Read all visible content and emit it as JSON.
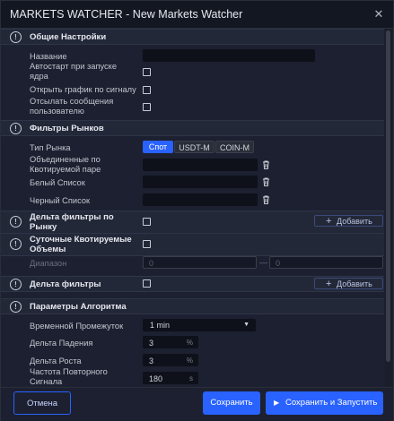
{
  "window": {
    "title": "MARKETS WATCHER - New Markets Watcher",
    "close": "✕"
  },
  "sections": {
    "general": {
      "title": "Общие Настройки",
      "icon": "info-icon"
    },
    "pair_filters": {
      "title": "Фильтры Рынков",
      "icon": "info-icon"
    },
    "delta_market": {
      "title": "Дельта фильтры по Рынку",
      "icon": "info-icon"
    },
    "daily_volumes": {
      "title": "Суточные Квотируемые Объемы",
      "icon": "info-icon"
    },
    "delta_filters": {
      "title": "Дельта фильтры",
      "icon": "info-icon"
    },
    "algo_params": {
      "title": "Параметры Алгоритма",
      "icon": "info-icon"
    }
  },
  "general": {
    "name_label": "Название",
    "name_value": "",
    "autostart_label": "Автостарт при запуске ядра",
    "autostart_checked": false,
    "open_chart_label": "Открыть график по сигналу",
    "open_chart_checked": false,
    "send_messages_label": "Отсылать сообщения пользователю",
    "send_messages_checked": false
  },
  "filters": {
    "market_type_label": "Тип Рынка",
    "market_types": [
      "Спот",
      "USDT-M",
      "COIN-M"
    ],
    "market_type_selected": "Спот",
    "merged_label": "Объединенные по Квотируемой паре",
    "whitelist_label": "Белый Список",
    "blacklist_label": "Черный Список"
  },
  "delta_market": {
    "checked": false,
    "add_label": "Добавить"
  },
  "daily_volumes": {
    "checked": false,
    "range_label": "Диапазон",
    "range_from": "0",
    "range_to": "0",
    "range_sep": "—"
  },
  "delta_filters": {
    "checked": false,
    "add_label": "Добавить"
  },
  "algo": {
    "timeframe_label": "Временной Промежуток",
    "timeframe_value": "1 min",
    "timeframe_caret": "▼",
    "delta_fall_label": "Дельта Падения",
    "delta_fall_value": "3",
    "delta_fall_unit": "%",
    "delta_rise_label": "Дельта Роста",
    "delta_rise_value": "3",
    "delta_rise_unit": "%",
    "repeat_label": "Частота Повторного Сигнала",
    "repeat_value": "180",
    "repeat_unit": "s"
  },
  "footer": {
    "cancel_label": "Отмена",
    "save_label": "Сохранить",
    "save_run_label": "Сохранить и Запустить",
    "save_run_icon": "▶"
  },
  "colors": {
    "accent": "#2962ff",
    "background": "#1c2030",
    "section": "#232839"
  }
}
